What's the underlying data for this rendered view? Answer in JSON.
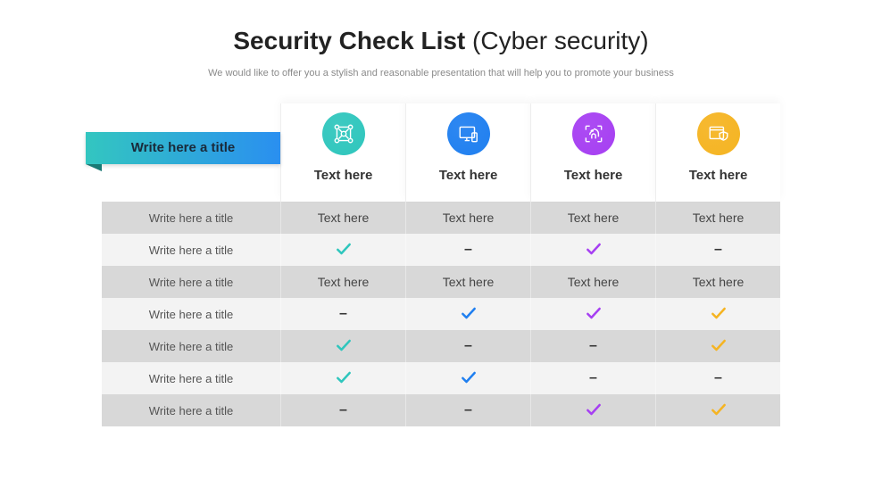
{
  "title": {
    "bold": "Security Check List",
    "light": " (Cyber security)"
  },
  "subtitle": "We would like to offer you a stylish and reasonable presentation that will help you to promote your business",
  "ribbon": "Write here a title",
  "columns": [
    {
      "label": "Text here",
      "color": "#2fc6bd",
      "icon": "network"
    },
    {
      "label": "Text here",
      "color": "#1f7ff0",
      "icon": "monitor"
    },
    {
      "label": "Text here",
      "color": "#a63ff2",
      "icon": "fingerprint"
    },
    {
      "label": "Text here",
      "color": "#f5b422",
      "icon": "browser-shield"
    }
  ],
  "rows": [
    {
      "label": "Write here a title",
      "cells": [
        "Text here",
        "Text here",
        "Text here",
        "Text here"
      ]
    },
    {
      "label": "Write here a title",
      "cells": [
        "check",
        "dash",
        "check",
        "dash"
      ]
    },
    {
      "label": "Write here a title",
      "cells": [
        "Text here",
        "Text here",
        "Text here",
        "Text here"
      ]
    },
    {
      "label": "Write here a title",
      "cells": [
        "dash",
        "check",
        "check",
        "check"
      ]
    },
    {
      "label": "Write here a title",
      "cells": [
        "check",
        "dash",
        "dash",
        "check"
      ]
    },
    {
      "label": "Write here a title",
      "cells": [
        "check",
        "check",
        "dash",
        "dash"
      ]
    },
    {
      "label": "Write here a title",
      "cells": [
        "dash",
        "dash",
        "check",
        "check"
      ]
    }
  ]
}
